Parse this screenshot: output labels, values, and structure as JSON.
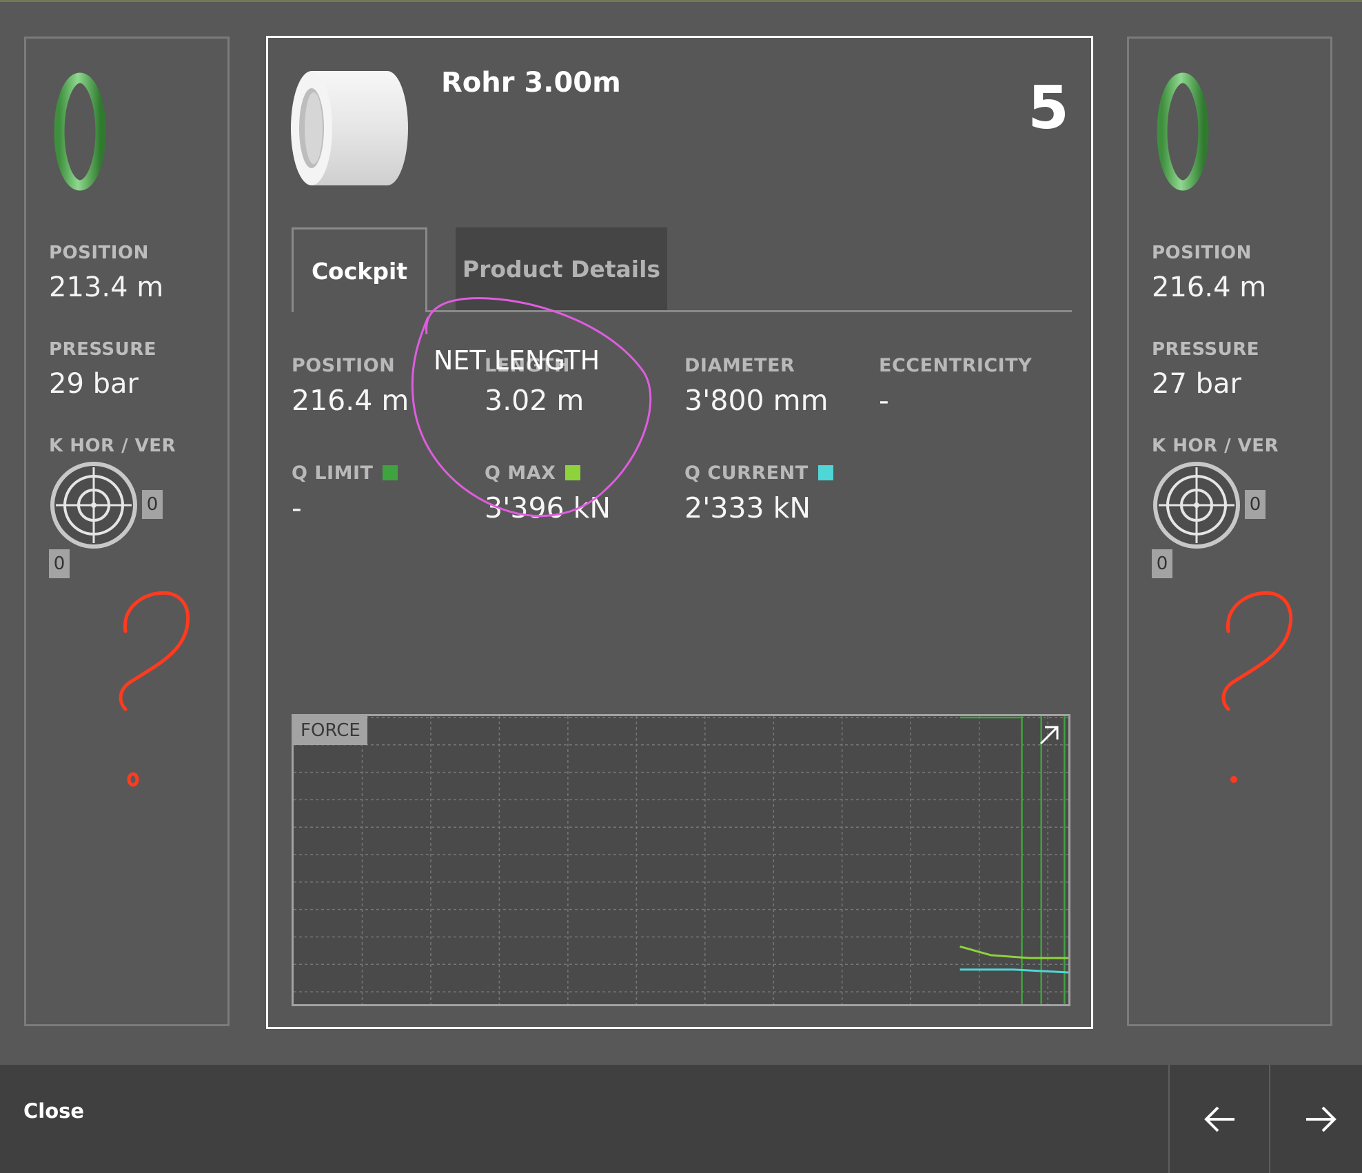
{
  "left_panel": {
    "position_label": "POSITION",
    "position_value": "213.4 m",
    "pressure_label": "PRESSURE",
    "pressure_value": "29 bar",
    "k_label": "K HOR / VER",
    "k_hor": "0",
    "k_ver": "0",
    "annotation": "?"
  },
  "right_panel": {
    "position_label": "POSITION",
    "position_value": "216.4 m",
    "pressure_label": "PRESSURE",
    "pressure_value": "27 bar",
    "k_label": "K HOR / VER",
    "k_hor": "0",
    "k_ver": "0",
    "annotation": "?"
  },
  "card": {
    "title": "Rohr 3.00m",
    "number": "5",
    "tabs": [
      {
        "label": "Cockpit",
        "active": true
      },
      {
        "label": "Product Details",
        "active": false
      }
    ],
    "fields": {
      "position": {
        "label": "POSITION",
        "value": "216.4 m"
      },
      "net_length": {
        "label": "LENGTH",
        "value": "3.02 m"
      },
      "diameter": {
        "label": "DIAMETER",
        "value": "3'800 mm"
      },
      "eccentricity": {
        "label": "ECCENTRICITY",
        "value": "-"
      },
      "q_limit": {
        "label": "Q LIMIT",
        "value": "-",
        "color": "#3fa33f"
      },
      "q_max": {
        "label": "Q MAX",
        "value": "3'396 kN",
        "color": "#8fd33c"
      },
      "q_current": {
        "label": "Q CURRENT",
        "value": "2'333 kN",
        "color": "#4fd6d6"
      }
    },
    "annotation_text": "NET LENGTH",
    "chart": {
      "title": "FORCE",
      "expand_icon": "expand-arrow-icon"
    }
  },
  "chart_data": {
    "type": "line",
    "title": "FORCE",
    "series": [
      {
        "color": "#8fd33c",
        "points": [
          [
            0.86,
            0.2
          ],
          [
            0.9,
            0.17
          ],
          [
            0.95,
            0.16
          ],
          [
            1.0,
            0.16
          ]
        ]
      },
      {
        "color": "#4fd6d6",
        "points": [
          [
            0.86,
            0.12
          ],
          [
            0.93,
            0.12
          ],
          [
            1.0,
            0.11
          ]
        ]
      }
    ],
    "markers": [
      {
        "color": "#3fa33f",
        "x": 0.94
      },
      {
        "color": "#3fa33f",
        "x": 0.965
      },
      {
        "color": "#3fa33f",
        "x": 0.995
      }
    ],
    "grid": true
  },
  "bottom_bar": {
    "close_label": "Close",
    "prev_icon": "arrow-left-icon",
    "next_icon": "arrow-right-icon"
  },
  "colors": {
    "background": "#585858",
    "bottom_bar": "#404040",
    "annotation_pink": "#e05ce0",
    "annotation_red": "#ff3b1f",
    "ring_green": "#4caf50"
  }
}
